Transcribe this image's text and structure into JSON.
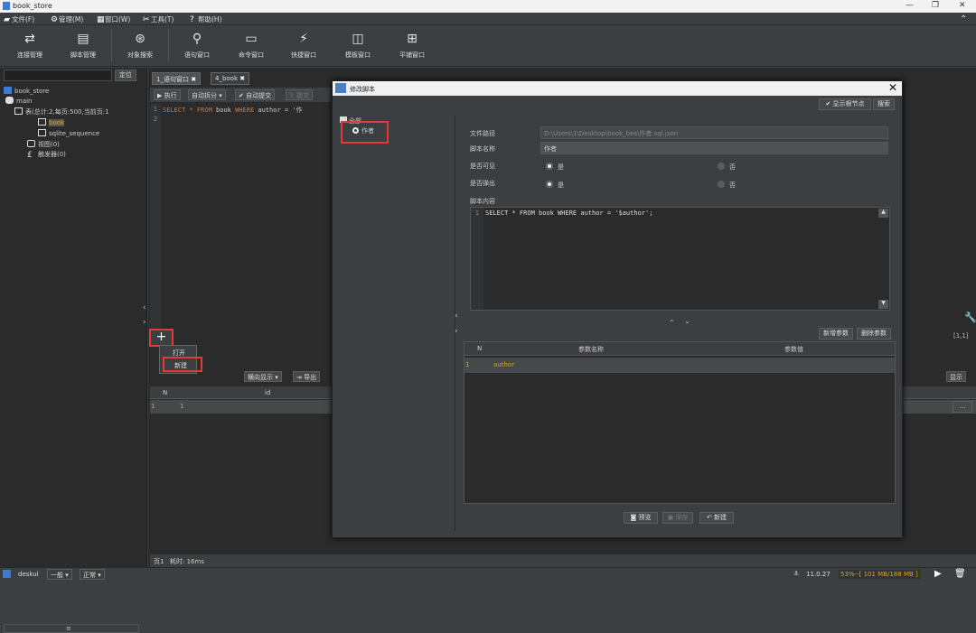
{
  "window": {
    "title": "book_store",
    "controls": [
      "—",
      "❐",
      "✕"
    ]
  },
  "menu": [
    {
      "icon": "folder-icon",
      "glyph": "▰",
      "label": "文件(F)"
    },
    {
      "icon": "gear-icon",
      "glyph": "⚙",
      "label": "管理(M)"
    },
    {
      "icon": "windows-icon",
      "glyph": "▦",
      "label": "窗口(W)"
    },
    {
      "icon": "tools-icon",
      "glyph": "✂",
      "label": "工具(T)"
    },
    {
      "icon": "help-icon",
      "glyph": "?",
      "label": "帮助(H)"
    }
  ],
  "collapse_glyph": "⌃",
  "toolbar": [
    {
      "icon": "connection-icon",
      "glyph": "⇄",
      "label": "连接管理"
    },
    {
      "icon": "script-icon",
      "glyph": "▤",
      "label": "脚本管理"
    },
    {
      "icon": "object-search-icon",
      "glyph": "⊛",
      "label": "对象搜索"
    },
    {
      "icon": "search-icon",
      "glyph": "⚲",
      "label": "语句窗口"
    },
    {
      "icon": "command-icon",
      "glyph": "▭",
      "label": "命令窗口"
    },
    {
      "icon": "quick-icon",
      "glyph": "⚡",
      "label": "快捷窗口"
    },
    {
      "icon": "template-icon",
      "glyph": "◫",
      "label": "模板窗口"
    },
    {
      "icon": "tile-icon",
      "glyph": "⊞",
      "label": "平铺窗口"
    }
  ],
  "left": {
    "locate_label": "定位",
    "tree": {
      "root": "book_store",
      "main": "main",
      "tables": "表(总计:2,每页:500,当前页:1",
      "book": "book",
      "sqlite_sequence": "sqlite_sequence",
      "views": "视图(0)",
      "triggers": "触发器(0)"
    },
    "scroll_label": "≡"
  },
  "tabs": [
    {
      "label": "1_语句窗口"
    },
    {
      "label": "4_book"
    }
  ],
  "editor": {
    "run_label": "执行",
    "auto_split_label": "自动拆分",
    "auto_commit_label": "自动提交",
    "commit_label": "提交",
    "line1": "1",
    "line2": "2",
    "code_keyword1": "SELECT * FROM",
    "code_table": " book ",
    "code_keyword2": "WHERE",
    "code_rest": " author = '作"
  },
  "context_menu": {
    "open": "打开",
    "new": "新建"
  },
  "plus_label": "+",
  "results": {
    "mode_label": "横向显示",
    "export_label": "导出",
    "show_label": "显示",
    "col_n": "N",
    "col_id": "id",
    "row_n": "1",
    "row_id": "1",
    "more": "...",
    "cursor_pos": "[1,1]"
  },
  "status": {
    "page": "页1",
    "time": "耗时: 16ms"
  },
  "bottom": {
    "user": "deskui",
    "mode": "一般",
    "state": "正常",
    "version": "11.0.27",
    "memory": "53%--[ 101 MB/188 MB ]"
  },
  "dialog": {
    "title": "修改脚本",
    "show_root_label": "显示根节点",
    "search_label": "搜索",
    "tree_root": "全部",
    "tree_item": "作者",
    "path_label": "文件路径",
    "path_value": "D:\\Users\\1\\Desktop\\book_bes\\作者.sql.json",
    "name_label": "脚本名称",
    "name_value": "作者",
    "visible_label": "是否可见",
    "popup_label": "是否弹出",
    "yes_label": "是",
    "no_label": "否",
    "content_label": "脚本内容",
    "script_line": "1",
    "script_text": "SELECT * FROM book WHERE author = '$author';",
    "add_param_label": "新增参数",
    "del_param_label": "删除参数",
    "col_n": "N",
    "col_name": "参数名称",
    "col_value": "参数值",
    "param_n": "1",
    "param_name": "author",
    "param_value": "",
    "preview_label": "预览",
    "save_label": "保存",
    "new_label": "新建"
  },
  "colors": {
    "highlight": "#e53935",
    "keyword": "#cc7832",
    "accent": "#e0a800"
  }
}
